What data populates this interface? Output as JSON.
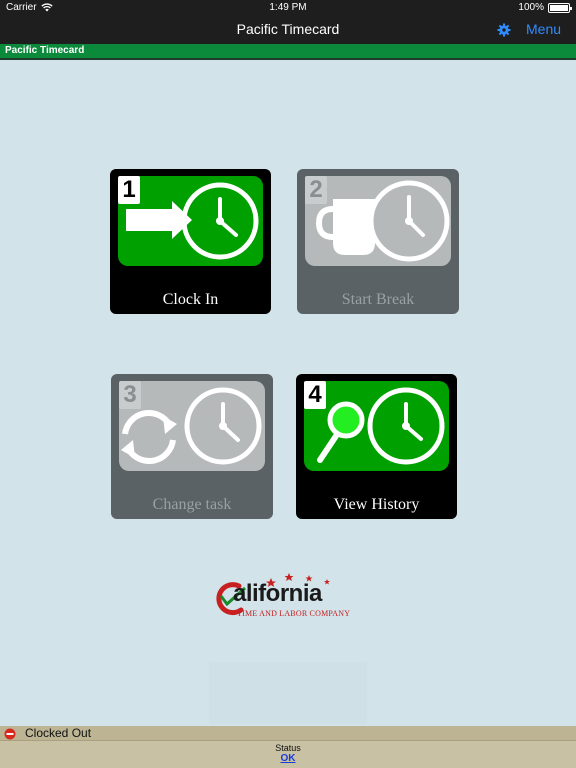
{
  "status_bar": {
    "carrier": "Carrier",
    "time": "1:49 PM",
    "battery": "100%"
  },
  "nav": {
    "title": "Pacific Timecard",
    "menu_label": "Menu"
  },
  "header_bar": {
    "title": "Pacific Timecard"
  },
  "tiles": [
    {
      "number": "1",
      "label": "Clock In",
      "enabled": true
    },
    {
      "number": "2",
      "label": "Start Break",
      "enabled": false
    },
    {
      "number": "3",
      "label": "Change task",
      "enabled": false
    },
    {
      "number": "4",
      "label": "View History",
      "enabled": true
    }
  ],
  "logo": {
    "word": "alifornia",
    "subtitle": "TIME AND LABOR COMPANY"
  },
  "footer": {
    "clock_status": "Clocked Out",
    "status_label": "Status",
    "status_value": "OK"
  },
  "colors": {
    "accent_green": "#00a000",
    "header_green": "#0a8a3a",
    "menu_blue": "#2f8cff",
    "ok_blue": "#1a3cd6"
  }
}
